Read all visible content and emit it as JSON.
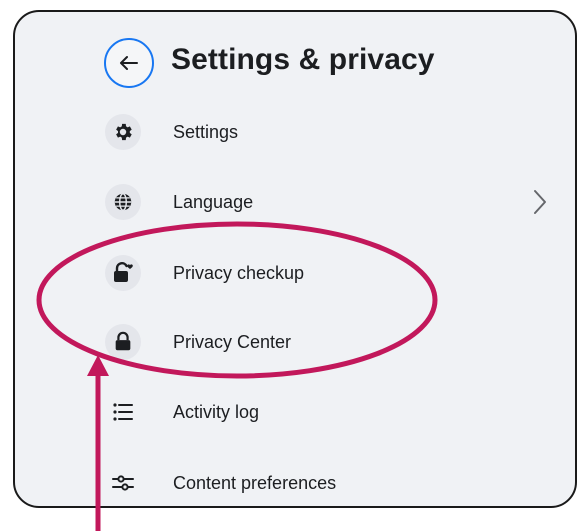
{
  "header": {
    "title": "Settings & privacy",
    "back_icon": "arrow-left-icon"
  },
  "menu": {
    "items": [
      {
        "label": "Settings",
        "icon": "gear-icon"
      },
      {
        "label": "Language",
        "icon": "globe-icon",
        "trailing_icon": "chevron-right-icon"
      },
      {
        "label": "Privacy checkup",
        "icon": "lock-heart-icon"
      },
      {
        "label": "Privacy Center",
        "icon": "lock-icon"
      },
      {
        "label": "Activity log",
        "icon": "list-icon"
      },
      {
        "label": "Content preferences",
        "icon": "sliders-icon"
      }
    ]
  },
  "annotation": {
    "color": "#c2185b",
    "shape": "ellipse-highlight",
    "pointer": "arrow-up"
  },
  "colors": {
    "background": "#f0f2f5",
    "accent": "#1877f2",
    "text": "#1c1e21",
    "icon_circle": "#e4e6eb"
  }
}
